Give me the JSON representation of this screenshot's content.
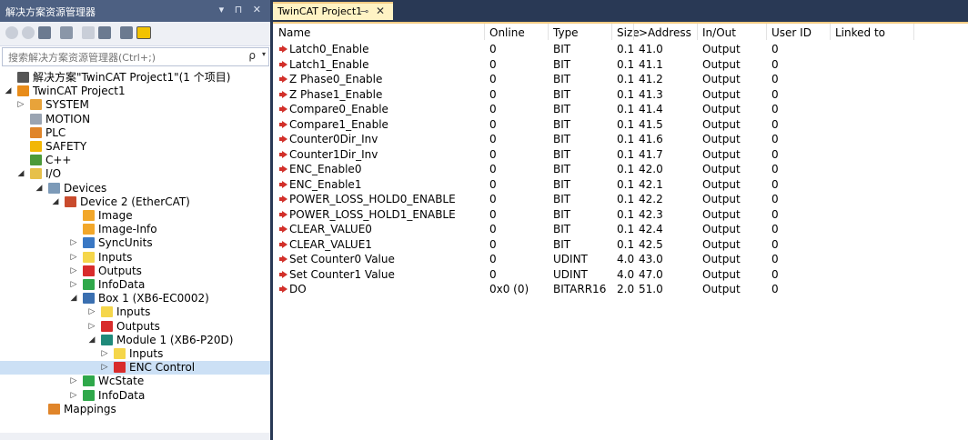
{
  "explorer": {
    "title": "解决方案资源管理器",
    "title_controls": "▾ ⊓ ✕",
    "search_placeholder": "搜索解决方案资源管理器(Ctrl+;)",
    "search_icon": "ρ",
    "search_dropdown": "▾",
    "tree": [
      {
        "label": "解决方案\"TwinCAT Project1\"(1 个项目)",
        "depth": 0,
        "expander": "",
        "icon": "solution-icon",
        "color": "#555555"
      },
      {
        "label": "TwinCAT Project1",
        "depth": 0,
        "expander": "◢",
        "icon": "project-icon",
        "color": "#e88c1a"
      },
      {
        "label": "SYSTEM",
        "depth": 1,
        "expander": "▷",
        "icon": "system-icon",
        "color": "#e8a33a"
      },
      {
        "label": "MOTION",
        "depth": 1,
        "expander": "",
        "icon": "motion-icon",
        "color": "#9aa4b2"
      },
      {
        "label": "PLC",
        "depth": 1,
        "expander": "",
        "icon": "plc-icon",
        "color": "#e0852a"
      },
      {
        "label": "SAFETY",
        "depth": 1,
        "expander": "",
        "icon": "safety-icon",
        "color": "#f2b705"
      },
      {
        "label": "C++",
        "depth": 1,
        "expander": "",
        "icon": "cpp-icon",
        "color": "#4c9a3a"
      },
      {
        "label": "I/O",
        "depth": 1,
        "expander": "◢",
        "icon": "io-icon",
        "color": "#e6c04a"
      },
      {
        "label": "Devices",
        "depth": 2,
        "expander": "◢",
        "icon": "devices-icon",
        "color": "#7c9ab8"
      },
      {
        "label": "Device 2 (EtherCAT)",
        "depth": 3,
        "expander": "◢",
        "icon": "ethercat-icon",
        "color": "#c94b2d"
      },
      {
        "label": "Image",
        "depth": 4,
        "expander": "",
        "icon": "image-icon",
        "color": "#f2a72a"
      },
      {
        "label": "Image-Info",
        "depth": 4,
        "expander": "",
        "icon": "image-info-icon",
        "color": "#f2a72a"
      },
      {
        "label": "SyncUnits",
        "depth": 4,
        "expander": "▷",
        "icon": "syncunits-icon",
        "color": "#3a78c4"
      },
      {
        "label": "Inputs",
        "depth": 4,
        "expander": "▷",
        "icon": "inputs-icon",
        "color": "#f5d64a"
      },
      {
        "label": "Outputs",
        "depth": 4,
        "expander": "▷",
        "icon": "outputs-icon",
        "color": "#d82b2b"
      },
      {
        "label": "InfoData",
        "depth": 4,
        "expander": "▷",
        "icon": "infodata-icon",
        "color": "#2fa84a"
      },
      {
        "label": "Box 1 (XB6-EC0002)",
        "depth": 4,
        "expander": "◢",
        "icon": "box-icon",
        "color": "#3a6fb0"
      },
      {
        "label": "Inputs",
        "depth": 5,
        "expander": "▷",
        "icon": "inputs-icon",
        "color": "#f5d64a"
      },
      {
        "label": "Outputs",
        "depth": 5,
        "expander": "▷",
        "icon": "outputs-icon",
        "color": "#d82b2b"
      },
      {
        "label": "Module 1 (XB6-P20D)",
        "depth": 5,
        "expander": "◢",
        "icon": "module-icon",
        "color": "#1f8a7a"
      },
      {
        "label": "Inputs",
        "depth": 6,
        "expander": "▷",
        "icon": "inputs-icon",
        "color": "#f5d64a"
      },
      {
        "label": "ENC Control",
        "depth": 6,
        "expander": "▷",
        "icon": "outputs-icon",
        "color": "#d82b2b",
        "selected": true
      },
      {
        "label": "WcState",
        "depth": 4,
        "expander": "▷",
        "icon": "wcstate-icon",
        "color": "#2fa84a"
      },
      {
        "label": "InfoData",
        "depth": 4,
        "expander": "▷",
        "icon": "infodata-icon",
        "color": "#2fa84a"
      },
      {
        "label": "Mappings",
        "depth": 2,
        "expander": "",
        "icon": "mappings-icon",
        "color": "#e0852a"
      }
    ]
  },
  "editor": {
    "tab_label": "TwinCAT Project1",
    "tab_pin": "⊸",
    "tab_close": "✕",
    "columns": [
      "Name",
      "Online",
      "Type",
      "Size",
      ">Address",
      "In/Out",
      "User ID",
      "Linked to"
    ],
    "rows": [
      [
        "Latch0_Enable",
        "0",
        "BIT",
        "0.1",
        "41.0",
        "Output",
        "0",
        ""
      ],
      [
        "Latch1_Enable",
        "0",
        "BIT",
        "0.1",
        "41.1",
        "Output",
        "0",
        ""
      ],
      [
        "Z Phase0_Enable",
        "0",
        "BIT",
        "0.1",
        "41.2",
        "Output",
        "0",
        ""
      ],
      [
        "Z Phase1_Enable",
        "0",
        "BIT",
        "0.1",
        "41.3",
        "Output",
        "0",
        ""
      ],
      [
        "Compare0_Enable",
        "0",
        "BIT",
        "0.1",
        "41.4",
        "Output",
        "0",
        ""
      ],
      [
        "Compare1_Enable",
        "0",
        "BIT",
        "0.1",
        "41.5",
        "Output",
        "0",
        ""
      ],
      [
        "Counter0Dir_Inv",
        "0",
        "BIT",
        "0.1",
        "41.6",
        "Output",
        "0",
        ""
      ],
      [
        "Counter1Dir_Inv",
        "0",
        "BIT",
        "0.1",
        "41.7",
        "Output",
        "0",
        ""
      ],
      [
        "ENC_Enable0",
        "0",
        "BIT",
        "0.1",
        "42.0",
        "Output",
        "0",
        ""
      ],
      [
        "ENC_Enable1",
        "0",
        "BIT",
        "0.1",
        "42.1",
        "Output",
        "0",
        ""
      ],
      [
        "POWER_LOSS_HOLD0_ENABLE",
        "0",
        "BIT",
        "0.1",
        "42.2",
        "Output",
        "0",
        ""
      ],
      [
        "POWER_LOSS_HOLD1_ENABLE",
        "0",
        "BIT",
        "0.1",
        "42.3",
        "Output",
        "0",
        ""
      ],
      [
        "CLEAR_VALUE0",
        "0",
        "BIT",
        "0.1",
        "42.4",
        "Output",
        "0",
        ""
      ],
      [
        "CLEAR_VALUE1",
        "0",
        "BIT",
        "0.1",
        "42.5",
        "Output",
        "0",
        ""
      ],
      [
        "Set Counter0 Value",
        "0",
        "UDINT",
        "4.0",
        "43.0",
        "Output",
        "0",
        ""
      ],
      [
        "Set Counter1 Value",
        "0",
        "UDINT",
        "4.0",
        "47.0",
        "Output",
        "0",
        ""
      ],
      [
        "DO",
        "0x0 (0)",
        "BITARR16",
        "2.0",
        "51.0",
        "Output",
        "0",
        ""
      ]
    ]
  }
}
